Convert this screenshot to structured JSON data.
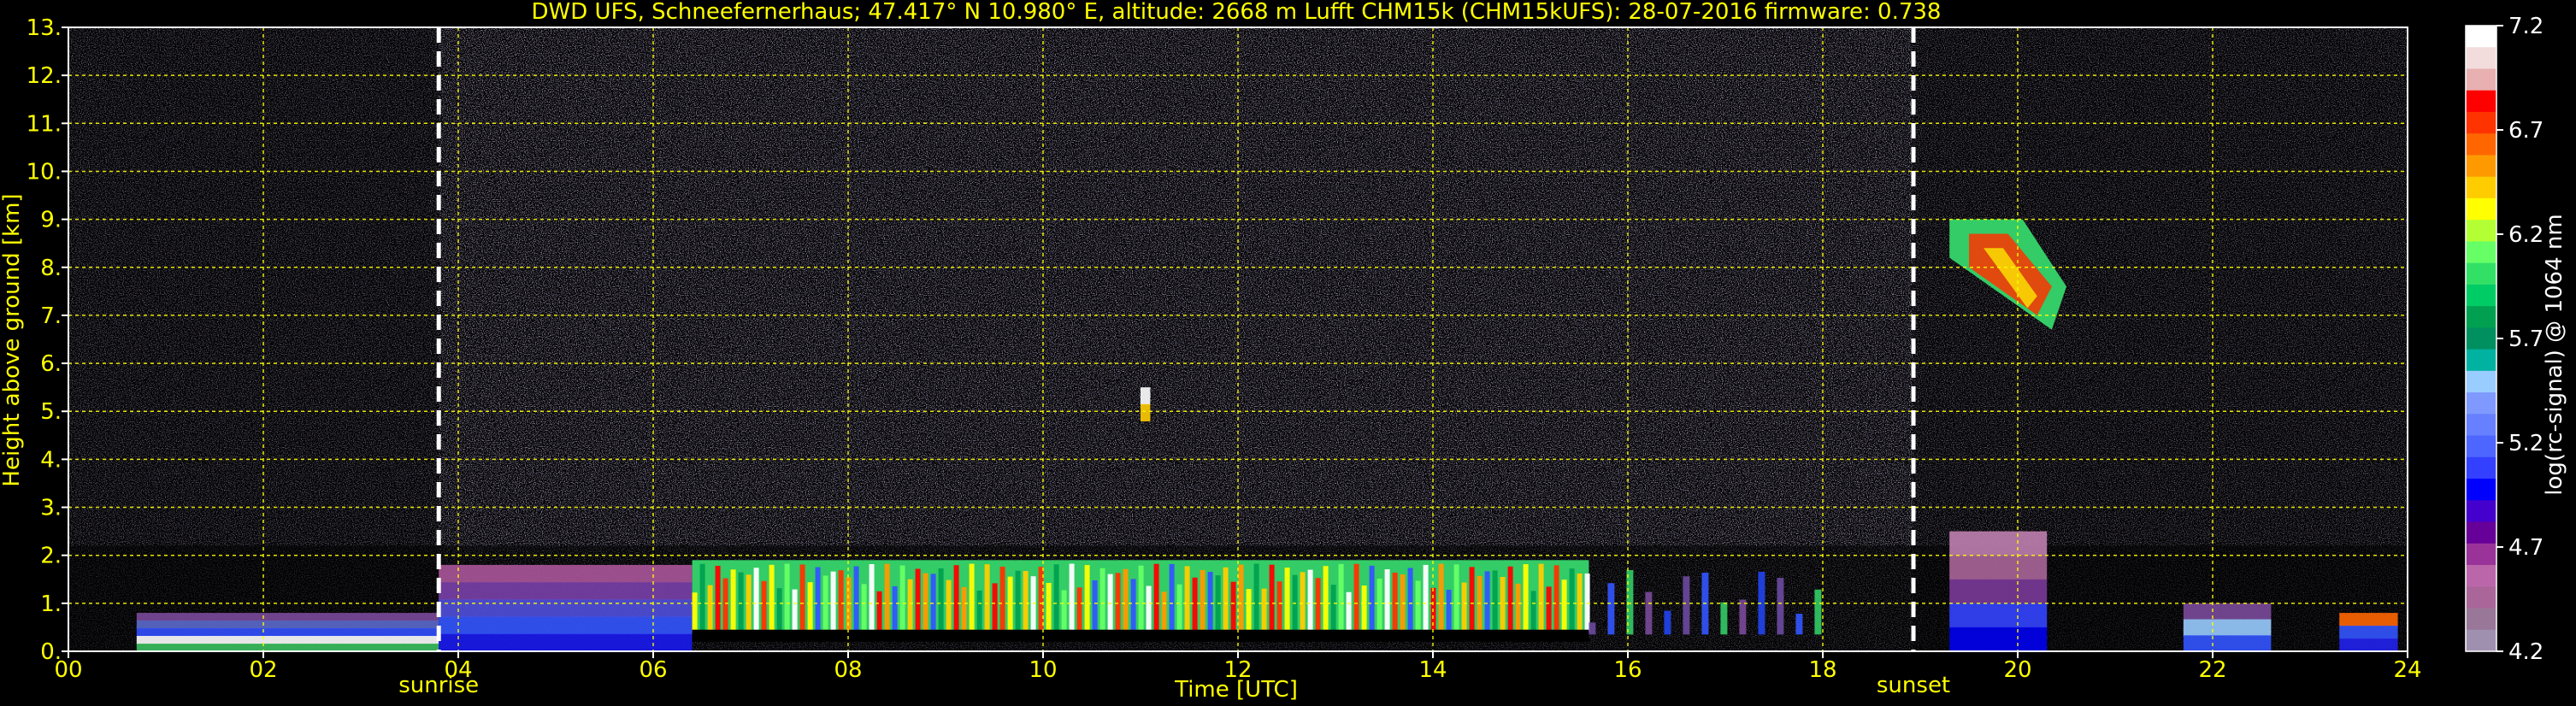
{
  "title": "DWD UFS, Schneefernerhaus; 47.417° N 10.980° E, altitude: 2668 m    Lufft CHM15k (CHM15kUFS): 28-07-2016    firmware: 0.738",
  "colors": {
    "text": "#ffff00",
    "grid": "#ffff00",
    "background": "#000000",
    "event_line": "#ffffff",
    "colorbar_label": "#ffffff"
  },
  "chart_data": {
    "type": "heatmap",
    "xlabel": "Time [UTC]",
    "ylabel": "Height above ground [km]",
    "xlim": [
      0,
      24
    ],
    "ylim": [
      0,
      13
    ],
    "x_tick_labels": [
      "00",
      "02",
      "04",
      "06",
      "08",
      "10",
      "12",
      "14",
      "16",
      "18",
      "20",
      "22",
      "24"
    ],
    "x_tick_values": [
      0,
      2,
      4,
      6,
      8,
      10,
      12,
      14,
      16,
      18,
      20,
      22,
      24
    ],
    "y_tick_labels": [
      "0.",
      "1.",
      "2.",
      "3.",
      "4.",
      "5.",
      "6.",
      "7.",
      "8.",
      "9.",
      "10.",
      "11.",
      "12.",
      "13."
    ],
    "y_tick_values": [
      0,
      1,
      2,
      3,
      4,
      5,
      6,
      7,
      8,
      9,
      10,
      11,
      12,
      13
    ],
    "grid": true,
    "events": [
      {
        "label": "sunrise",
        "time": 3.8
      },
      {
        "label": "sunset",
        "time": 18.93
      }
    ],
    "colorbar": {
      "label": "log(rc-signal) @ 1064 nm",
      "range": [
        4.2,
        7.2
      ],
      "tick_labels": [
        "7.2",
        "6.7",
        "6.2",
        "5.7",
        "5.2",
        "4.7",
        "4.2"
      ],
      "tick_values": [
        7.2,
        6.7,
        6.2,
        5.7,
        5.2,
        4.7,
        4.2
      ],
      "colors": [
        "#ffffff",
        "#f2dcdc",
        "#e8b0b0",
        "#ff0000",
        "#ff3300",
        "#ff6600",
        "#ff9900",
        "#ffcc00",
        "#ffff00",
        "#b3ff33",
        "#66ff66",
        "#33e066",
        "#00cc66",
        "#00a050",
        "#009060",
        "#00b3a0",
        "#99ccff",
        "#8099ff",
        "#6680ff",
        "#4d66ff",
        "#3340ff",
        "#0000ff",
        "#4400cc",
        "#660099",
        "#993399",
        "#bb66aa",
        "#aa6699",
        "#997799",
        "#a090b0"
      ]
    },
    "features": [
      {
        "name": "boundary layer aerosol",
        "t_start": 0.7,
        "t_end": 3.8,
        "h_min": 0.0,
        "h_max": 0.8
      },
      {
        "name": "boundary layer aerosol",
        "t_start": 3.8,
        "t_end": 6.4,
        "h_min": 0.0,
        "h_max": 1.8
      },
      {
        "name": "low cloud layer",
        "t_start": 6.4,
        "t_end": 15.6,
        "h_min": 0.4,
        "h_max": 1.9
      },
      {
        "name": "broken clouds",
        "t_start": 15.6,
        "t_end": 18.0,
        "h_min": 0.4,
        "h_max": 1.8
      },
      {
        "name": "evening aerosol",
        "t_start": 19.3,
        "t_end": 20.3,
        "h_min": 0.0,
        "h_max": 2.5
      },
      {
        "name": "mid-level cloud",
        "t_start": 19.3,
        "t_end": 20.5,
        "h_min": 6.7,
        "h_max": 9.0
      },
      {
        "name": "small cloud",
        "t_start": 11.0,
        "t_end": 11.1,
        "h_min": 4.8,
        "h_max": 5.5
      },
      {
        "name": "late aerosol",
        "t_start": 21.7,
        "t_end": 22.6,
        "h_min": 0.0,
        "h_max": 1.0
      },
      {
        "name": "late aerosol",
        "t_start": 23.3,
        "t_end": 23.9,
        "h_min": 0.0,
        "h_max": 0.8
      }
    ]
  }
}
